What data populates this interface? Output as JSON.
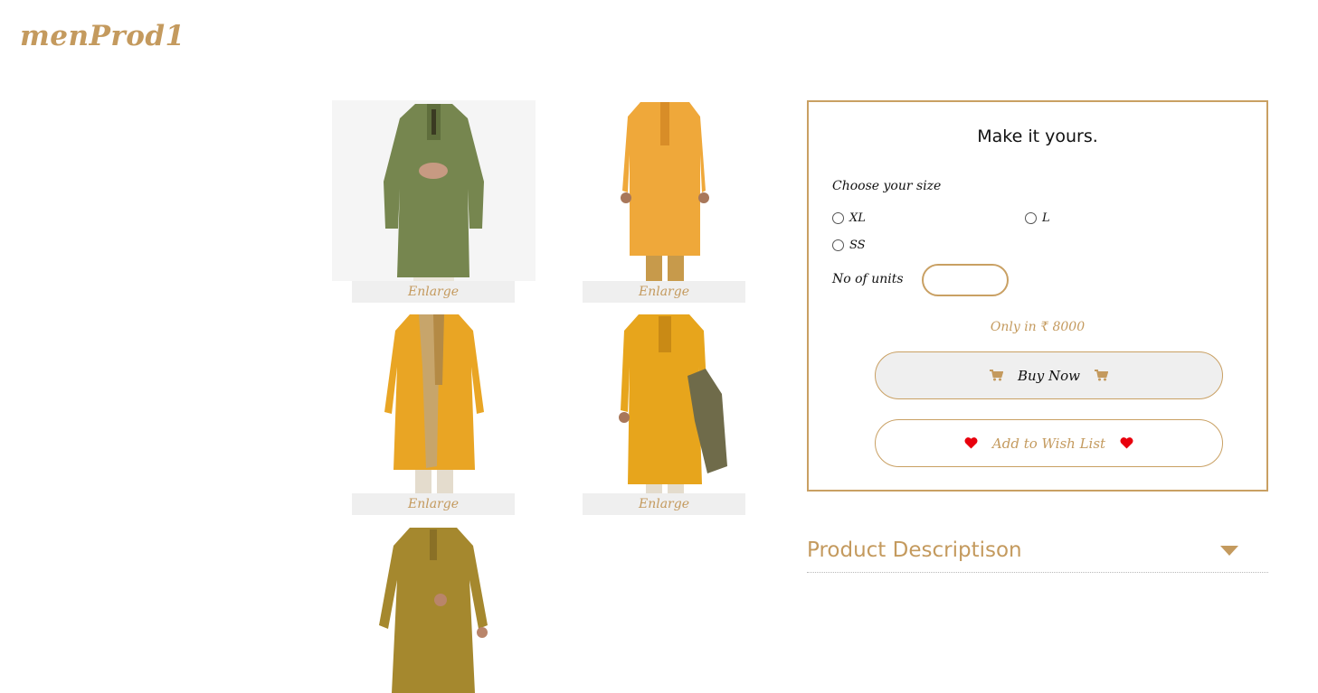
{
  "brand": {
    "name": "menProd1"
  },
  "gallery": {
    "items": [
      {
        "label": "Enlarge",
        "garment_color": "#76864f",
        "bg": "#f5f5f5"
      },
      {
        "label": "Enlarge",
        "garment_color": "#efa83a",
        "bg": "#ffffff"
      },
      {
        "label": "Enlarge",
        "garment_color": "#e9a524",
        "bg": "#ffffff"
      },
      {
        "label": "Enlarge",
        "garment_color": "#e7a51c",
        "bg": "#ffffff"
      },
      {
        "garment_color": "#a5882e",
        "bg": "#ffffff"
      }
    ]
  },
  "panel": {
    "title": "Make it yours.",
    "size_label": "Choose your size",
    "sizes": [
      {
        "label": "XL",
        "selected": false
      },
      {
        "label": "L",
        "selected": false
      },
      {
        "label": "SS",
        "selected": false
      }
    ],
    "units_label": "No of units",
    "units_value": "",
    "price_text": "Only in ₹ 8000",
    "buy_label": "Buy Now",
    "wish_label": "Add to Wish List"
  },
  "description": {
    "title": "Product Descriptison"
  },
  "colors": {
    "accent": "#c49a5e",
    "border": "#c9a063",
    "heart": "#e8000d",
    "button_bg": "#efefef"
  },
  "icons": {
    "cart": "shopping-cart-icon",
    "heart": "heart-icon",
    "caret": "caret-down-icon"
  }
}
